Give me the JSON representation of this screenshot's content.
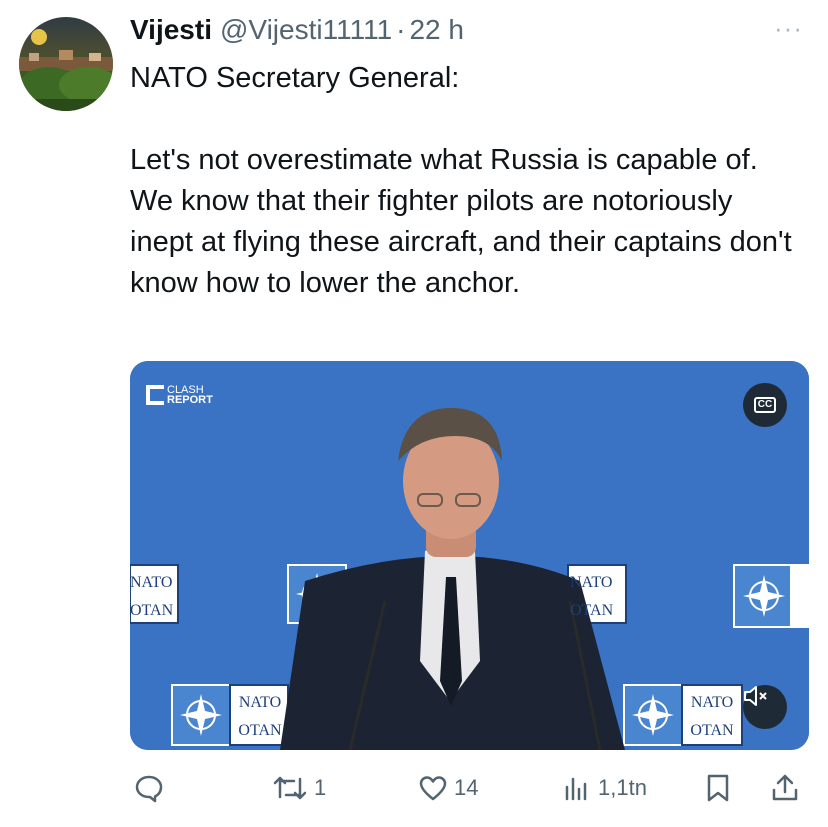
{
  "tweet": {
    "display_name": "Vijesti",
    "handle": "@Vijesti11111",
    "separator": "·",
    "time": "22 h",
    "text": "NATO Secretary General:\n\nLet's not overestimate what Russia is capable of. We know that their fighter pilots are notoriously inept at flying these aircraft, and their captains don't know how to lower the anchor.",
    "more_icon": "more-icon"
  },
  "media": {
    "logo_line1": "CLASH",
    "logo_line2": "REPORT",
    "background_color": "#3a73c4",
    "cc_label": "CC",
    "backdrop_labels": {
      "nato": "NATO",
      "otan": "OTAN"
    }
  },
  "actions": {
    "reply_count": "",
    "retweet_count": "1",
    "like_count": "14",
    "views_count": "1,1tn"
  },
  "colors": {
    "text": "#0f1419",
    "secondary": "#536471",
    "media_bg": "#3a73c4"
  }
}
